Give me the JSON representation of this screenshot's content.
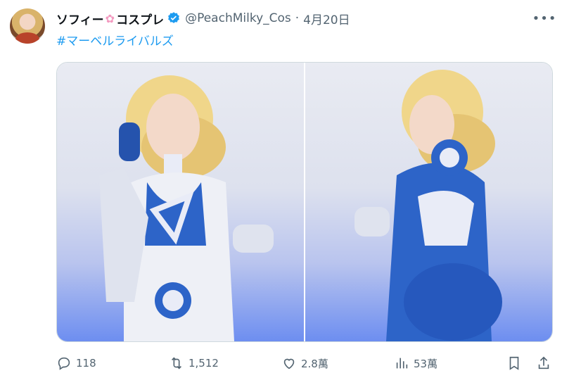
{
  "tweet": {
    "display_name": "ソフィー",
    "name_suffix": "コスプレ",
    "handle": "@PeachMilky_Cos",
    "separator": "·",
    "date": "4月20日",
    "hashtag": "#マーベルライバルズ"
  },
  "icons": {
    "avatar": "profile-avatar",
    "flower": "cherry-blossom-emoji",
    "verified": "verified-badge-icon",
    "more": "more-icon",
    "reply": "reply-icon",
    "retweet": "retweet-icon",
    "like": "heart-icon",
    "views": "analytics-icon",
    "bookmark": "bookmark-icon",
    "share": "share-icon"
  },
  "stats": {
    "replies": "118",
    "retweets": "1,512",
    "likes": "2.8萬",
    "views": "53萬"
  },
  "colors": {
    "accent": "#1d9bf0",
    "muted": "#536471",
    "text": "#0f1419"
  }
}
